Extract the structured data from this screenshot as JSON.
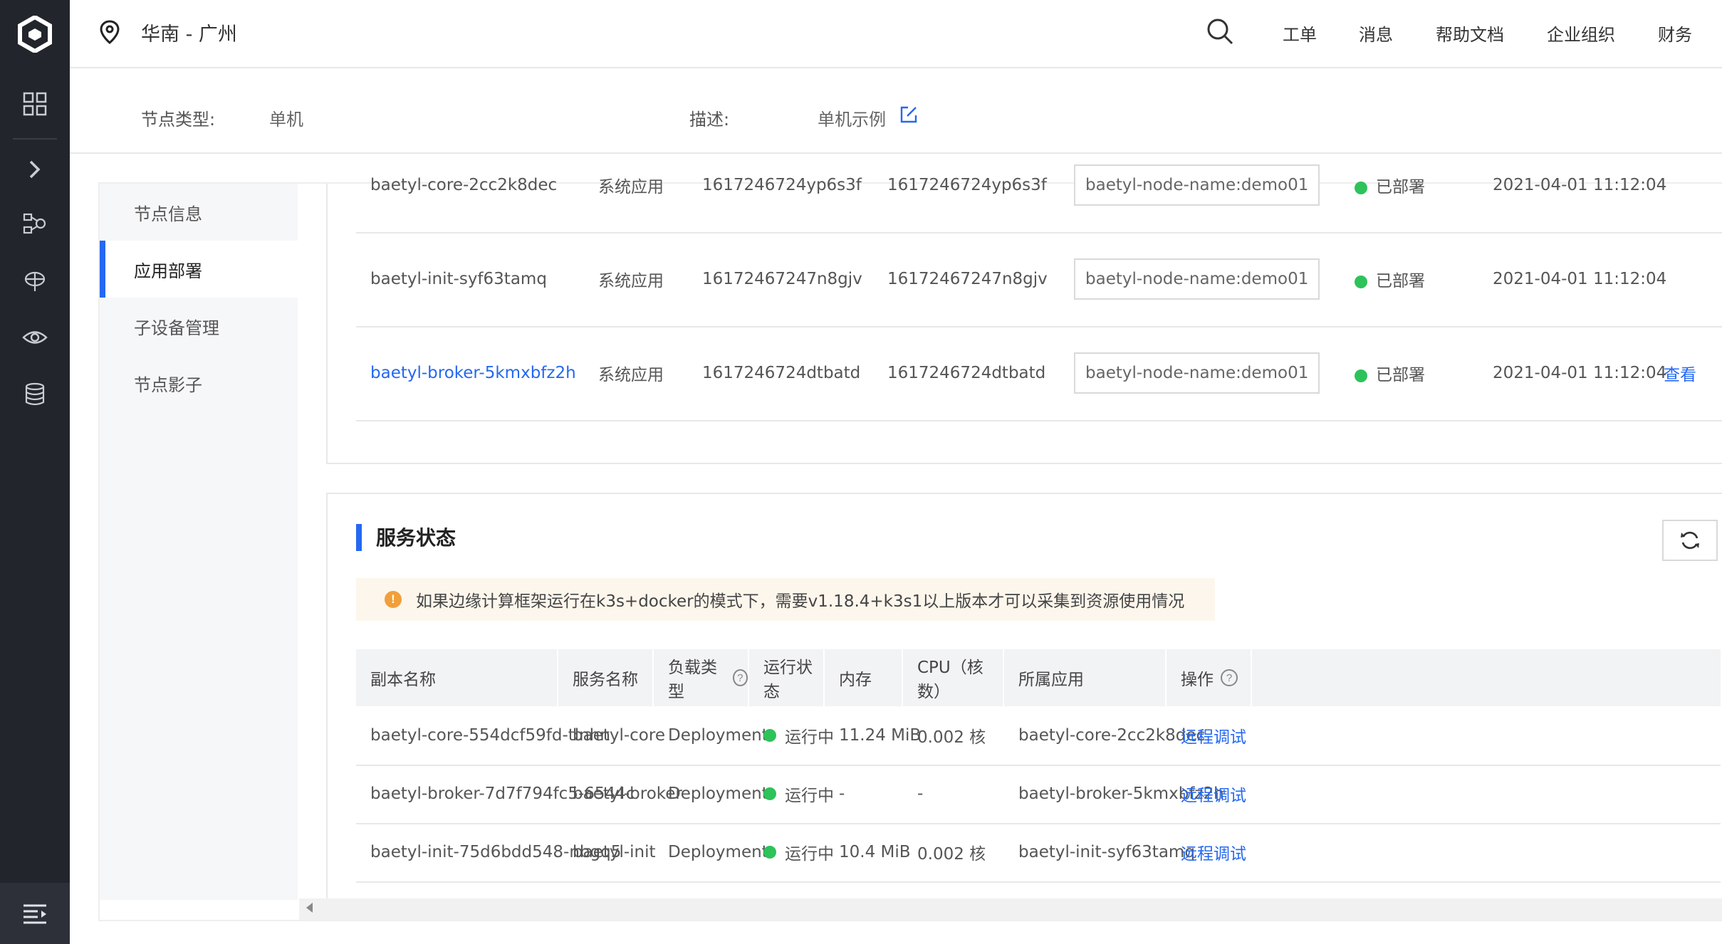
{
  "header": {
    "region": "华南 - 广州",
    "nav": [
      "工单",
      "消息",
      "帮助文档",
      "企业组织",
      "财务"
    ]
  },
  "summary": {
    "node_type_label": "节点类型:",
    "node_type_value": "单机",
    "desc_label": "描述:",
    "desc_value": "单机示例"
  },
  "subnav": {
    "items": [
      "节点信息",
      "应用部署",
      "子设备管理",
      "节点影子"
    ],
    "active": "应用部署"
  },
  "apps": {
    "rows": [
      {
        "name": "baetyl-core-2cc2k8dec",
        "type": "系统应用",
        "col3": "1617246724yp6s3f",
        "col4": "1617246724yp6s3f",
        "label": "baetyl-node-name:demo01",
        "status": "已部署",
        "time": "2021-04-01 11:12:04",
        "action": ""
      },
      {
        "name": "baetyl-init-syf63tamq",
        "type": "系统应用",
        "col3": "16172467247n8gjv",
        "col4": "16172467247n8gjv",
        "label": "baetyl-node-name:demo01",
        "status": "已部署",
        "time": "2021-04-01 11:12:04",
        "action": ""
      },
      {
        "name": "baetyl-broker-5kmxbfz2h",
        "type": "系统应用",
        "col3": "1617246724dtbatd",
        "col4": "1617246724dtbatd",
        "label": "baetyl-node-name:demo01",
        "status": "已部署",
        "time": "2021-04-01 11:12:04",
        "action": "查看"
      }
    ]
  },
  "service_status": {
    "title": "服务状态",
    "notice": "如果边缘计算框架运行在k3s+docker的模式下，需要v1.18.4+k3s1以上版本才可以采集到资源使用情况",
    "notice_icon": "!",
    "columns": [
      "副本名称",
      "服务名称",
      "负载类型",
      "运行状态",
      "内存",
      "CPU（核数）",
      "所属应用",
      "操作"
    ],
    "help_mark": "?",
    "rows": [
      {
        "replica": "baetyl-core-554dcf59fd-tlnhn",
        "service": "baetyl-core",
        "workload": "Deployment",
        "status": "运行中",
        "memory": "11.24 MiB",
        "cpu": "0.002 核",
        "app": "baetyl-core-2cc2k8dec",
        "action": "远程调试"
      },
      {
        "replica": "baetyl-broker-7d7f794fc5-6544c",
        "service": "baetyl-broker",
        "workload": "Deployment",
        "status": "运行中",
        "memory": "-",
        "cpu": "-",
        "app": "baetyl-broker-5kmxbfz2h",
        "action": "远程调试"
      },
      {
        "replica": "baetyl-init-75d6bdd548-nbgq5",
        "service": "baetyl-init",
        "workload": "Deployment",
        "status": "运行中",
        "memory": "10.4 MiB",
        "cpu": "0.002 核",
        "app": "baetyl-init-syf63tamq",
        "action": "远程调试"
      }
    ]
  },
  "colors": {
    "accent": "#2468f2",
    "sidebar_bg": "#22252c",
    "status_green": "#2ec25b",
    "warning": "#f29f3a"
  }
}
